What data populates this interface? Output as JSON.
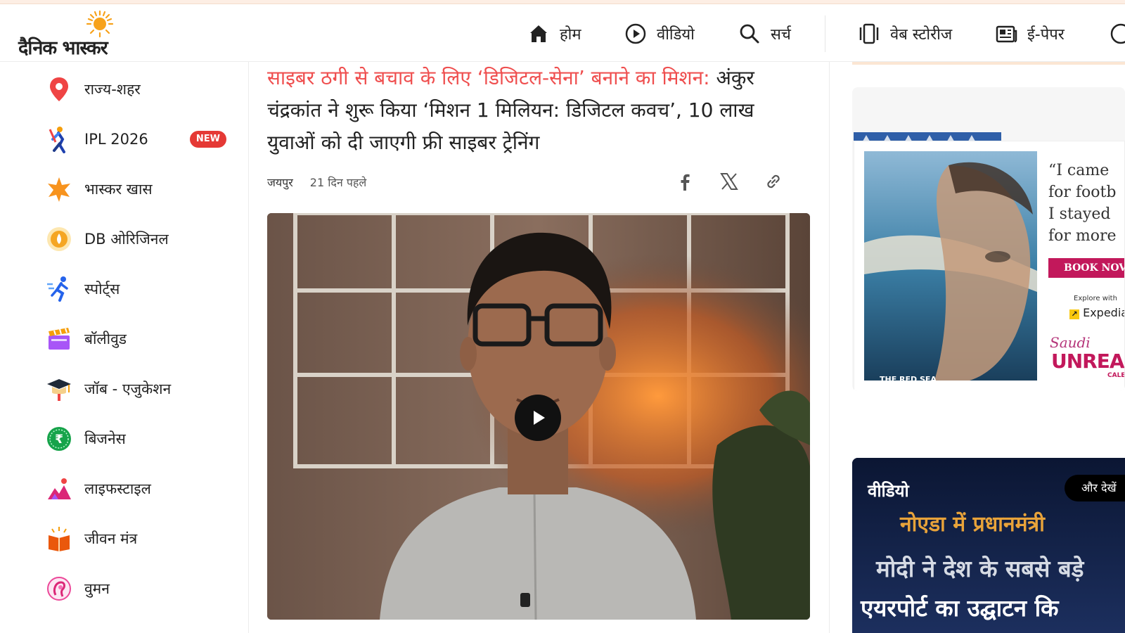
{
  "brand": {
    "name": "दैनिक भास्कर"
  },
  "nav": [
    {
      "label": "होम",
      "icon": "home-icon"
    },
    {
      "label": "वीडियो",
      "icon": "play-circle-icon"
    },
    {
      "label": "सर्च",
      "icon": "search-icon"
    },
    {
      "label": "वेब स्टोरीज",
      "icon": "web-stories-icon"
    },
    {
      "label": "ई-पेपर",
      "icon": "newspaper-icon"
    }
  ],
  "sidebar": {
    "items": [
      {
        "label": "राज्य-शहर",
        "icon": "location-pin-icon"
      },
      {
        "label": "IPL 2026",
        "icon": "cricket-player-icon",
        "badge": "NEW"
      },
      {
        "label": "भास्कर खास",
        "icon": "star-icon"
      },
      {
        "label": "DB ओरिजिनल",
        "icon": "db-original-icon"
      },
      {
        "label": "स्पोर्ट्स",
        "icon": "running-icon"
      },
      {
        "label": "बॉलीवुड",
        "icon": "clapperboard-icon"
      },
      {
        "label": "जॉब - एजुकेशन",
        "icon": "graduation-cap-icon"
      },
      {
        "label": "बिजनेस",
        "icon": "rupee-icon"
      },
      {
        "label": "लाइफस्टाइल",
        "icon": "lifestyle-icon"
      },
      {
        "label": "जीवन मंत्र",
        "icon": "book-icon"
      },
      {
        "label": "वुमन",
        "icon": "woman-icon"
      }
    ]
  },
  "article": {
    "kicker": "साइबर ठगी से बचाव के लिए ‘डिजिटल-सेना’ बनाने का मिशन:",
    "headline": " अंकुर चंद्रकांत ने शुरू किया ‘मिशन 1 मिलियन: डिजिटल कवच’, 10 लाख युवाओं को दी जाएगी फ्री साइबर ट्रेनिंग",
    "city": "जयपुर",
    "time": "21 दिन पहले"
  },
  "ad": {
    "quote_lines": [
      "“I came",
      "for footb",
      "I stayed",
      "for more"
    ],
    "book": "BOOK NOV",
    "explore": "Explore with",
    "expedia": "Expedia",
    "saudi": "Saudi",
    "unreal": "UNREAL",
    "cal": "CALE",
    "location": "THE RED SEA"
  },
  "video_section": {
    "title": "वीडियो",
    "more": "और देखें",
    "line1": "नोएडा में प्रधानमंत्री",
    "line2": "मोदी ने देश के सबसे बड़े",
    "line3": "एयरपोर्ट का उद्घाटन कि"
  },
  "colors": {
    "accent": "#ef4e4e",
    "badge": "#e53935",
    "sun": "#f7a21b"
  }
}
